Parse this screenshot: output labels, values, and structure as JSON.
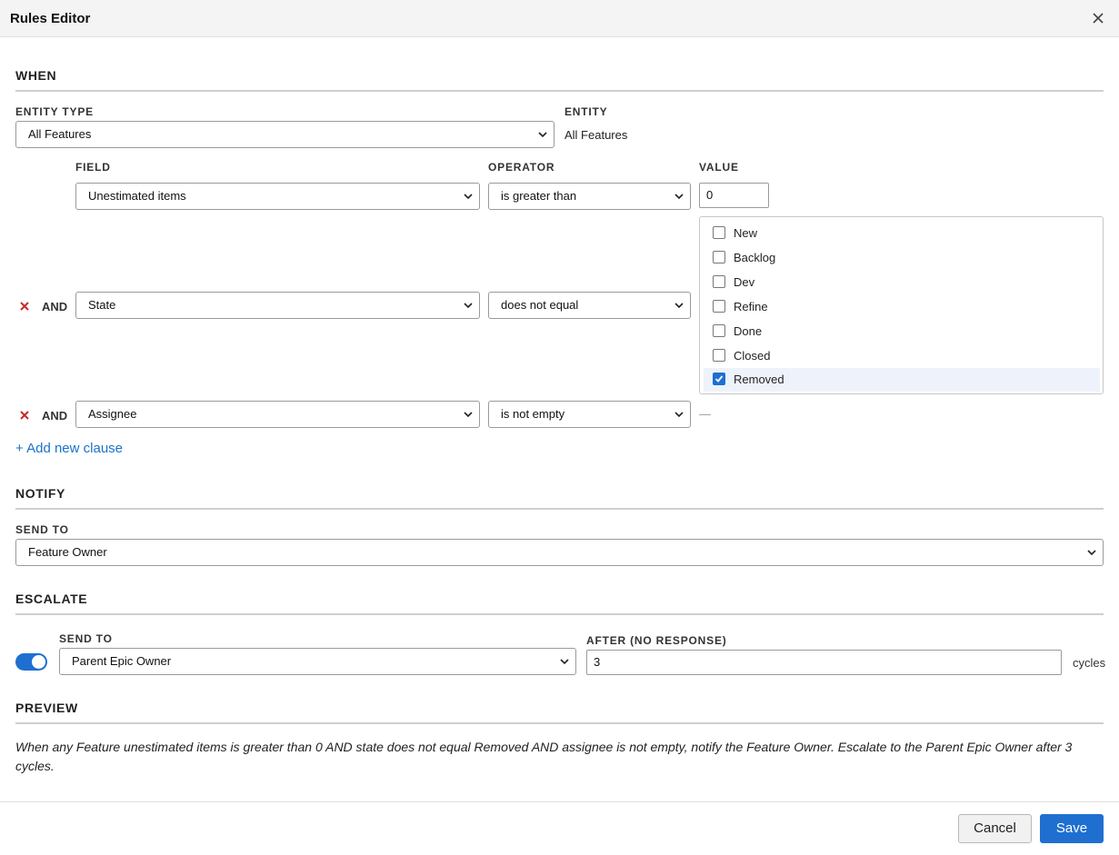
{
  "dialog": {
    "title": "Rules Editor"
  },
  "when": {
    "section_title": "WHEN",
    "entity_type_label": "ENTITY TYPE",
    "entity_type_value": "All Features",
    "entity_label": "ENTITY",
    "entity_value": "All Features",
    "field_header": "FIELD",
    "operator_header": "OPERATOR",
    "value_header": "VALUE",
    "clauses": [
      {
        "field": "Unestimated items",
        "operator": "is greater than",
        "value": "0"
      },
      {
        "conjunction": "AND",
        "field": "State",
        "operator": "does not equal",
        "states": [
          {
            "label": "New",
            "checked": false
          },
          {
            "label": "Backlog",
            "checked": false
          },
          {
            "label": "Dev",
            "checked": false
          },
          {
            "label": "Refine",
            "checked": false
          },
          {
            "label": "Done",
            "checked": false
          },
          {
            "label": "Closed",
            "checked": false
          },
          {
            "label": "Removed",
            "checked": true
          }
        ]
      },
      {
        "conjunction": "AND",
        "field": "Assignee",
        "operator": "is not empty",
        "value": "—"
      }
    ],
    "add_clause": "+ Add new clause"
  },
  "notify": {
    "section_title": "NOTIFY",
    "send_to_label": "SEND TO",
    "send_to_value": "Feature Owner"
  },
  "escalate": {
    "section_title": "ESCALATE",
    "enabled": true,
    "send_to_label": "SEND TO",
    "send_to_value": "Parent Epic Owner",
    "after_label": "AFTER (NO RESPONSE)",
    "after_value": "3",
    "unit": "cycles"
  },
  "preview": {
    "section_title": "PREVIEW",
    "text": "When any Feature unestimated items is greater than 0 AND state does not equal Removed AND assignee is not empty, notify the Feature Owner. Escalate to the Parent Epic Owner after 3 cycles."
  },
  "footer": {
    "cancel_label": "Cancel",
    "save_label": "Save"
  },
  "colors": {
    "accent": "#1f6fd1",
    "link": "#1a73c8",
    "remove": "#c62828"
  }
}
